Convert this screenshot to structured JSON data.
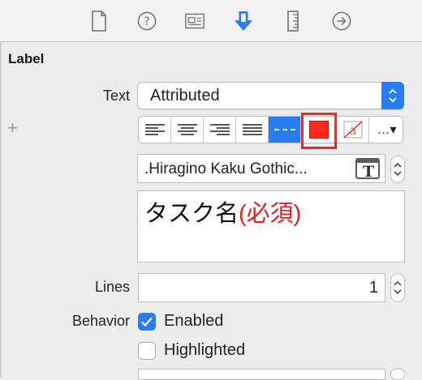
{
  "section": {
    "title": "Label"
  },
  "text_row": {
    "label": "Text",
    "value": "Attributed"
  },
  "toolbar": {
    "items": [
      {
        "name": "align-left-icon"
      },
      {
        "name": "align-center-icon"
      },
      {
        "name": "align-right-icon"
      },
      {
        "name": "align-justify-icon"
      },
      {
        "name": "align-natural-icon",
        "selected": true
      },
      {
        "name": "text-color-icon",
        "color": "#ff2a1a"
      },
      {
        "name": "background-color-icon"
      },
      {
        "name": "more-menu-icon",
        "label": "…▾"
      }
    ],
    "add_label": "+"
  },
  "font": {
    "name": ".Hiragino Kaku Gothic..."
  },
  "text": {
    "primary": "タスク名",
    "red_part": "(必須)",
    "red_color": "#e02020"
  },
  "lines": {
    "label": "Lines",
    "value": "1"
  },
  "behavior": {
    "label": "Behavior",
    "enabled": {
      "label": "Enabled",
      "checked": true
    },
    "highlighted": {
      "label": "Highlighted",
      "checked": false
    }
  },
  "colors": {
    "accent": "#2a7cf0",
    "highlight_box": "#e62e2e"
  }
}
